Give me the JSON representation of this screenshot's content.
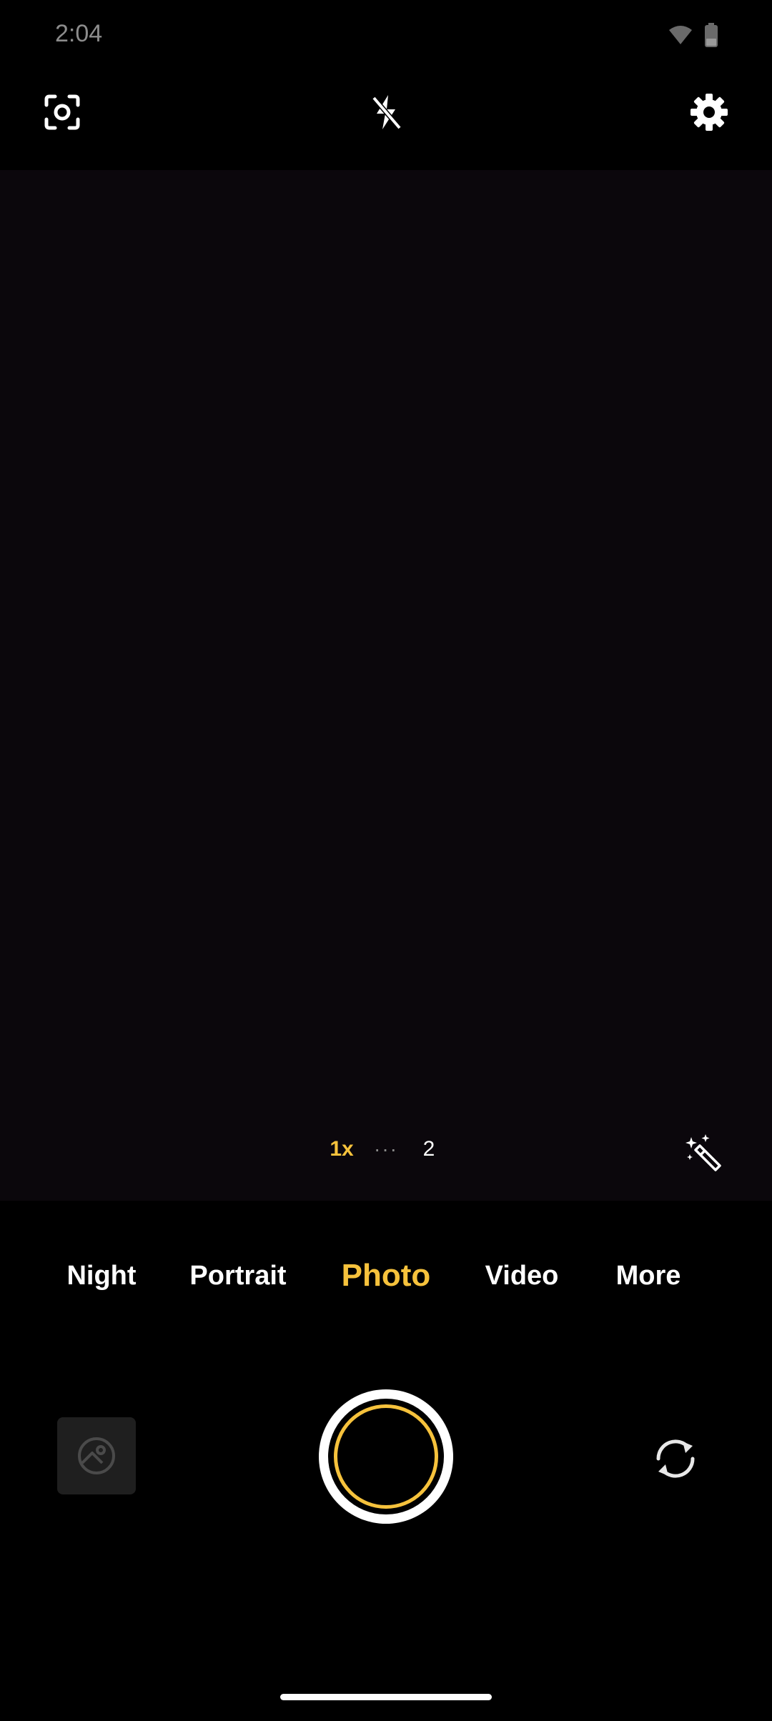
{
  "status_bar": {
    "time": "2:04"
  },
  "top_bar": {
    "icons": [
      "scan-icon",
      "flash-off-icon",
      "gear-icon"
    ]
  },
  "zoom": {
    "current": "1x",
    "dots": "···",
    "next": "2"
  },
  "modes": [
    {
      "label": "Night"
    },
    {
      "label": "Portrait"
    },
    {
      "label": "Photo"
    },
    {
      "label": "Video"
    },
    {
      "label": "More"
    }
  ],
  "active_mode": "Photo",
  "colors": {
    "accent": "#f6c23c",
    "viewfinder": "#0b070c",
    "background": "#000000"
  }
}
